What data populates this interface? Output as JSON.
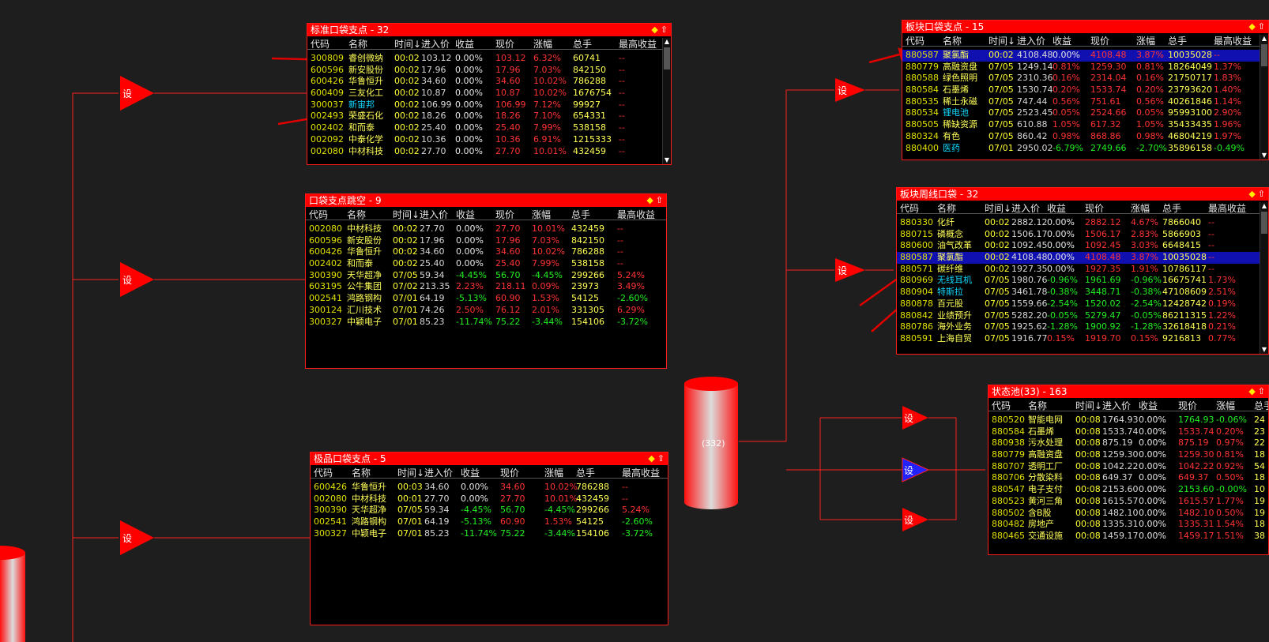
{
  "colors": {
    "background": "#1e1e1e",
    "accent": "#ff0000",
    "selected_row": "#1010b0",
    "rise": "#ff3333",
    "fall": "#22ee22",
    "switch_selected": "#2222ff"
  },
  "nodes": {
    "setting_label": "设",
    "pool_count": "(332)"
  },
  "panels": {
    "std": {
      "title": "标准口袋支点 - 32",
      "headers": [
        "代码",
        "名称",
        "时间↓",
        "进入价",
        "收益",
        "现价",
        "涨幅",
        "总手",
        "最高收益"
      ],
      "rows": [
        {
          "code": "300809",
          "name": "睿创微纳",
          "time": "00:02",
          "in": "103.12",
          "gain": "0.00%",
          "price": "103.12",
          "chg": "6.32%",
          "vol": "60741",
          "max": "--",
          "gc": "w",
          "pc": "r",
          "cc": "r"
        },
        {
          "code": "600596",
          "name": "新安股份",
          "time": "00:02",
          "in": "17.96",
          "gain": "0.00%",
          "price": "17.96",
          "chg": "7.03%",
          "vol": "842150",
          "max": "--",
          "gc": "w",
          "pc": "r",
          "cc": "r"
        },
        {
          "code": "600426",
          "name": "华鲁恒升",
          "time": "00:02",
          "in": "34.60",
          "gain": "0.00%",
          "price": "34.60",
          "chg": "10.02%",
          "vol": "786288",
          "max": "--",
          "gc": "w",
          "pc": "r",
          "cc": "r"
        },
        {
          "code": "600409",
          "name": "三友化工",
          "time": "00:02",
          "in": "10.87",
          "gain": "0.00%",
          "price": "10.87",
          "chg": "10.02%",
          "vol": "1676754",
          "max": "--",
          "gc": "w",
          "pc": "r",
          "cc": "r"
        },
        {
          "code": "300037",
          "name": "新宙邦",
          "time": "00:02",
          "in": "106.99",
          "gain": "0.00%",
          "price": "106.99",
          "chg": "7.12%",
          "vol": "99927",
          "max": "--",
          "gc": "w",
          "pc": "r",
          "cc": "r",
          "cyan": true
        },
        {
          "code": "002493",
          "name": "荣盛石化",
          "time": "00:02",
          "in": "18.26",
          "gain": "0.00%",
          "price": "18.26",
          "chg": "7.10%",
          "vol": "654331",
          "max": "--",
          "gc": "w",
          "pc": "r",
          "cc": "r"
        },
        {
          "code": "002402",
          "name": "和而泰",
          "time": "00:02",
          "in": "25.40",
          "gain": "0.00%",
          "price": "25.40",
          "chg": "7.99%",
          "vol": "538158",
          "max": "--",
          "gc": "w",
          "pc": "r",
          "cc": "r"
        },
        {
          "code": "002092",
          "name": "中泰化学",
          "time": "00:02",
          "in": "10.36",
          "gain": "0.00%",
          "price": "10.36",
          "chg": "6.91%",
          "vol": "1215333",
          "max": "--",
          "gc": "w",
          "pc": "r",
          "cc": "r"
        },
        {
          "code": "002080",
          "name": "中材科技",
          "time": "00:02",
          "in": "27.70",
          "gain": "0.00%",
          "price": "27.70",
          "chg": "10.01%",
          "vol": "432459",
          "max": "--",
          "gc": "w",
          "pc": "r",
          "cc": "r"
        }
      ]
    },
    "gap": {
      "title": "口袋支点跳空 - 9",
      "headers": [
        "代码",
        "名称",
        "时间↓",
        "进入价",
        "收益",
        "现价",
        "涨幅",
        "总手",
        "最高收益"
      ],
      "rows": [
        {
          "code": "002080",
          "name": "中材科技",
          "time": "00:02",
          "in": "27.70",
          "gain": "0.00%",
          "price": "27.70",
          "chg": "10.01%",
          "vol": "432459",
          "max": "--",
          "gc": "w",
          "pc": "r",
          "cc": "r"
        },
        {
          "code": "600596",
          "name": "新安股份",
          "time": "00:02",
          "in": "17.96",
          "gain": "0.00%",
          "price": "17.96",
          "chg": "7.03%",
          "vol": "842150",
          "max": "--",
          "gc": "w",
          "pc": "r",
          "cc": "r"
        },
        {
          "code": "600426",
          "name": "华鲁恒升",
          "time": "00:02",
          "in": "34.60",
          "gain": "0.00%",
          "price": "34.60",
          "chg": "10.02%",
          "vol": "786288",
          "max": "--",
          "gc": "w",
          "pc": "r",
          "cc": "r"
        },
        {
          "code": "002402",
          "name": "和而泰",
          "time": "00:02",
          "in": "25.40",
          "gain": "0.00%",
          "price": "25.40",
          "chg": "7.99%",
          "vol": "538158",
          "max": "--",
          "gc": "w",
          "pc": "r",
          "cc": "r"
        },
        {
          "code": "300390",
          "name": "天华超净",
          "time": "07/05",
          "in": "59.34",
          "gain": "-4.45%",
          "price": "56.70",
          "chg": "-4.45%",
          "vol": "299266",
          "max": "5.24%",
          "gc": "g",
          "pc": "g",
          "cc": "g",
          "mc": "r"
        },
        {
          "code": "603195",
          "name": "公牛集团",
          "time": "07/02",
          "in": "213.35",
          "gain": "2.23%",
          "price": "218.11",
          "chg": "0.09%",
          "vol": "23973",
          "max": "3.49%",
          "gc": "r",
          "pc": "r",
          "cc": "r",
          "mc": "r"
        },
        {
          "code": "002541",
          "name": "鸿路钢构",
          "time": "07/01",
          "in": "64.19",
          "gain": "-5.13%",
          "price": "60.90",
          "chg": "1.53%",
          "vol": "54125",
          "max": "-2.60%",
          "gc": "g",
          "pc": "r",
          "cc": "r",
          "mc": "g"
        },
        {
          "code": "300124",
          "name": "汇川技术",
          "time": "07/01",
          "in": "74.26",
          "gain": "2.50%",
          "price": "76.12",
          "chg": "2.01%",
          "vol": "331305",
          "max": "6.29%",
          "gc": "r",
          "pc": "r",
          "cc": "r",
          "mc": "r"
        },
        {
          "code": "300327",
          "name": "中颖电子",
          "time": "07/01",
          "in": "85.23",
          "gain": "-11.74%",
          "price": "75.22",
          "chg": "-3.44%",
          "vol": "154106",
          "max": "-3.72%",
          "gc": "g",
          "pc": "g",
          "cc": "g",
          "mc": "g"
        }
      ]
    },
    "elite": {
      "title": "极品口袋支点 - 5",
      "headers": [
        "代码",
        "名称",
        "时间↓",
        "进入价",
        "收益",
        "现价",
        "涨幅",
        "总手",
        "最高收益"
      ],
      "rows": [
        {
          "code": "600426",
          "name": "华鲁恒升",
          "time": "00:03",
          "in": "34.60",
          "gain": "0.00%",
          "price": "34.60",
          "chg": "10.02%",
          "vol": "786288",
          "max": "--",
          "gc": "w",
          "pc": "r",
          "cc": "r"
        },
        {
          "code": "002080",
          "name": "中材科技",
          "time": "00:01",
          "in": "27.70",
          "gain": "0.00%",
          "price": "27.70",
          "chg": "10.01%",
          "vol": "432459",
          "max": "--",
          "gc": "w",
          "pc": "r",
          "cc": "r"
        },
        {
          "code": "300390",
          "name": "天华超净",
          "time": "07/05",
          "in": "59.34",
          "gain": "-4.45%",
          "price": "56.70",
          "chg": "-4.45%",
          "vol": "299266",
          "max": "5.24%",
          "gc": "g",
          "pc": "g",
          "cc": "g",
          "mc": "r"
        },
        {
          "code": "002541",
          "name": "鸿路钢构",
          "time": "07/01",
          "in": "64.19",
          "gain": "-5.13%",
          "price": "60.90",
          "chg": "1.53%",
          "vol": "54125",
          "max": "-2.60%",
          "gc": "g",
          "pc": "r",
          "cc": "r",
          "mc": "g"
        },
        {
          "code": "300327",
          "name": "中颖电子",
          "time": "07/01",
          "in": "85.23",
          "gain": "-11.74%",
          "price": "75.22",
          "chg": "-3.44%",
          "vol": "154106",
          "max": "-3.72%",
          "gc": "g",
          "pc": "g",
          "cc": "g",
          "mc": "g"
        }
      ]
    },
    "sector": {
      "title": "板块口袋支点 - 15",
      "headers": [
        "代码",
        "名称",
        "时间↓",
        "进入价",
        "收益",
        "现价",
        "涨幅",
        "总手",
        "最高收益"
      ],
      "rows": [
        {
          "code": "880587",
          "name": "聚氯酯",
          "time": "00:02",
          "in": "4108.48",
          "gain": "0.00%",
          "price": "4108.48",
          "chg": "3.87%",
          "vol": "10035028",
          "max": "--",
          "gc": "w",
          "pc": "r",
          "cc": "r",
          "sel": true
        },
        {
          "code": "880779",
          "name": "高融资盘",
          "time": "07/05",
          "in": "1249.14",
          "gain": "0.81%",
          "price": "1259.30",
          "chg": "0.81%",
          "vol": "18264049",
          "max": "1.37%",
          "gc": "r",
          "pc": "r",
          "cc": "r",
          "mc": "r"
        },
        {
          "code": "880588",
          "name": "绿色照明",
          "time": "07/05",
          "in": "2310.36",
          "gain": "0.16%",
          "price": "2314.04",
          "chg": "0.16%",
          "vol": "21750717",
          "max": "1.83%",
          "gc": "r",
          "pc": "r",
          "cc": "r",
          "mc": "r"
        },
        {
          "code": "880584",
          "name": "石墨烯",
          "time": "07/05",
          "in": "1530.74",
          "gain": "0.20%",
          "price": "1533.74",
          "chg": "0.20%",
          "vol": "23793620",
          "max": "1.40%",
          "gc": "r",
          "pc": "r",
          "cc": "r",
          "mc": "r"
        },
        {
          "code": "880535",
          "name": "稀土永磁",
          "time": "07/05",
          "in": "747.44",
          "gain": "0.56%",
          "price": "751.61",
          "chg": "0.56%",
          "vol": "40261846",
          "max": "1.14%",
          "gc": "r",
          "pc": "r",
          "cc": "r",
          "mc": "r"
        },
        {
          "code": "880534",
          "name": "锂电池",
          "time": "07/05",
          "in": "2523.45",
          "gain": "0.05%",
          "price": "2524.66",
          "chg": "0.05%",
          "vol": "95993100",
          "max": "2.90%",
          "gc": "r",
          "pc": "r",
          "cc": "r",
          "mc": "r",
          "cyan": true
        },
        {
          "code": "880505",
          "name": "稀缺资源",
          "time": "07/05",
          "in": "610.88",
          "gain": "1.05%",
          "price": "617.32",
          "chg": "1.05%",
          "vol": "35433435",
          "max": "1.96%",
          "gc": "r",
          "pc": "r",
          "cc": "r",
          "mc": "r"
        },
        {
          "code": "880324",
          "name": "有色",
          "time": "07/05",
          "in": "860.42",
          "gain": "0.98%",
          "price": "868.86",
          "chg": "0.98%",
          "vol": "46804219",
          "max": "1.97%",
          "gc": "r",
          "pc": "r",
          "cc": "r",
          "mc": "r"
        },
        {
          "code": "880400",
          "name": "医药",
          "time": "07/01",
          "in": "2950.02",
          "gain": "-6.79%",
          "price": "2749.66",
          "chg": "-2.70%",
          "vol": "35896158",
          "max": "-0.49%",
          "gc": "g",
          "pc": "g",
          "cc": "g",
          "mc": "g",
          "cyan": true
        }
      ]
    },
    "weekly": {
      "title": "板块周线口袋 - 32",
      "headers": [
        "代码",
        "名称",
        "时间↓",
        "进入价",
        "收益",
        "现价",
        "涨幅",
        "总手",
        "最高收益"
      ],
      "rows": [
        {
          "code": "880330",
          "name": "化纤",
          "time": "00:02",
          "in": "2882.12",
          "gain": "0.00%",
          "price": "2882.12",
          "chg": "4.67%",
          "vol": "7866040",
          "max": "--",
          "gc": "w",
          "pc": "r",
          "cc": "r"
        },
        {
          "code": "880715",
          "name": "磷概念",
          "time": "00:02",
          "in": "1506.17",
          "gain": "0.00%",
          "price": "1506.17",
          "chg": "2.83%",
          "vol": "5866903",
          "max": "--",
          "gc": "w",
          "pc": "r",
          "cc": "r"
        },
        {
          "code": "880600",
          "name": "油气改革",
          "time": "00:02",
          "in": "1092.45",
          "gain": "0.00%",
          "price": "1092.45",
          "chg": "3.03%",
          "vol": "6648415",
          "max": "--",
          "gc": "w",
          "pc": "r",
          "cc": "r"
        },
        {
          "code": "880587",
          "name": "聚氯酯",
          "time": "00:02",
          "in": "4108.48",
          "gain": "0.00%",
          "price": "4108.48",
          "chg": "3.87%",
          "vol": "10035028",
          "max": "--",
          "gc": "w",
          "pc": "r",
          "cc": "r",
          "sel": true
        },
        {
          "code": "880571",
          "name": "碳纤维",
          "time": "00:02",
          "in": "1927.35",
          "gain": "0.00%",
          "price": "1927.35",
          "chg": "1.91%",
          "vol": "10786117",
          "max": "--",
          "gc": "w",
          "pc": "r",
          "cc": "r"
        },
        {
          "code": "880969",
          "name": "无线耳机",
          "time": "07/05",
          "in": "1980.76",
          "gain": "-0.96%",
          "price": "1961.69",
          "chg": "-0.96%",
          "vol": "16675741",
          "max": "1.73%",
          "gc": "g",
          "pc": "g",
          "cc": "g",
          "mc": "r",
          "cyan": true
        },
        {
          "code": "880904",
          "name": "特斯拉",
          "time": "07/05",
          "in": "3461.78",
          "gain": "-0.38%",
          "price": "3448.71",
          "chg": "-0.38%",
          "vol": "47108609",
          "max": "2.51%",
          "gc": "g",
          "pc": "g",
          "cc": "g",
          "mc": "r",
          "cyan": true
        },
        {
          "code": "880878",
          "name": "百元股",
          "time": "07/05",
          "in": "1559.66",
          "gain": "-2.54%",
          "price": "1520.02",
          "chg": "-2.54%",
          "vol": "12428742",
          "max": "0.19%",
          "gc": "g",
          "pc": "g",
          "cc": "g",
          "mc": "r"
        },
        {
          "code": "880842",
          "name": "业绩预升",
          "time": "07/05",
          "in": "5282.20",
          "gain": "-0.05%",
          "price": "5279.47",
          "chg": "-0.05%",
          "vol": "86211315",
          "max": "1.22%",
          "gc": "g",
          "pc": "g",
          "cc": "g",
          "mc": "r"
        },
        {
          "code": "880786",
          "name": "海外业务",
          "time": "07/05",
          "in": "1925.62",
          "gain": "-1.28%",
          "price": "1900.92",
          "chg": "-1.28%",
          "vol": "32618418",
          "max": "0.21%",
          "gc": "g",
          "pc": "g",
          "cc": "g",
          "mc": "r"
        },
        {
          "code": "880591",
          "name": "上海自贸",
          "time": "07/05",
          "in": "1916.77",
          "gain": "0.15%",
          "price": "1919.70",
          "chg": "0.15%",
          "vol": "9216813",
          "max": "0.77%",
          "gc": "r",
          "pc": "r",
          "cc": "r",
          "mc": "r"
        }
      ]
    },
    "state": {
      "title": "状态池(33) - 163",
      "headers": [
        "代码",
        "名称",
        "时间↓",
        "进入价",
        "收益",
        "现价",
        "涨幅",
        "总手"
      ],
      "rows": [
        {
          "code": "880520",
          "name": "智能电网",
          "time": "00:08",
          "in": "1764.93",
          "gain": "0.00%",
          "price": "1764.93",
          "chg": "-0.06%",
          "vol": "24",
          "gc": "w",
          "pc": "g",
          "cc": "g"
        },
        {
          "code": "880584",
          "name": "石墨烯",
          "time": "00:08",
          "in": "1533.74",
          "gain": "0.00%",
          "price": "1533.74",
          "chg": "0.20%",
          "vol": "23",
          "gc": "w",
          "pc": "r",
          "cc": "r"
        },
        {
          "code": "880938",
          "name": "污水处理",
          "time": "00:08",
          "in": "875.19",
          "gain": "0.00%",
          "price": "875.19",
          "chg": "0.97%",
          "vol": "22",
          "gc": "w",
          "pc": "r",
          "cc": "r"
        },
        {
          "code": "880779",
          "name": "高融资盘",
          "time": "00:08",
          "in": "1259.30",
          "gain": "0.00%",
          "price": "1259.30",
          "chg": "0.81%",
          "vol": "18",
          "gc": "w",
          "pc": "r",
          "cc": "r"
        },
        {
          "code": "880707",
          "name": "透明工厂",
          "time": "00:08",
          "in": "1042.22",
          "gain": "0.00%",
          "price": "1042.22",
          "chg": "0.92%",
          "vol": "54",
          "gc": "w",
          "pc": "r",
          "cc": "r"
        },
        {
          "code": "880706",
          "name": "分散染料",
          "time": "00:08",
          "in": "649.37",
          "gain": "0.00%",
          "price": "649.37",
          "chg": "0.50%",
          "vol": "18",
          "gc": "w",
          "pc": "r",
          "cc": "r"
        },
        {
          "code": "880547",
          "name": "电子支付",
          "time": "00:08",
          "in": "2153.60",
          "gain": "0.00%",
          "price": "2153.60",
          "chg": "-0.00%",
          "vol": "10",
          "gc": "w",
          "pc": "g",
          "cc": "g"
        },
        {
          "code": "880523",
          "name": "黄河三角",
          "time": "00:08",
          "in": "1615.57",
          "gain": "0.00%",
          "price": "1615.57",
          "chg": "1.77%",
          "vol": "19",
          "gc": "w",
          "pc": "r",
          "cc": "r"
        },
        {
          "code": "880502",
          "name": "含B股",
          "time": "00:08",
          "in": "1482.10",
          "gain": "0.00%",
          "price": "1482.10",
          "chg": "0.50%",
          "vol": "19",
          "gc": "w",
          "pc": "r",
          "cc": "r"
        },
        {
          "code": "880482",
          "name": "房地产",
          "time": "00:08",
          "in": "1335.31",
          "gain": "0.00%",
          "price": "1335.31",
          "chg": "1.54%",
          "vol": "18",
          "gc": "w",
          "pc": "r",
          "cc": "r"
        },
        {
          "code": "880465",
          "name": "交通设施",
          "time": "00:08",
          "in": "1459.17",
          "gain": "0.00%",
          "price": "1459.17",
          "chg": "1.51%",
          "vol": "38",
          "gc": "w",
          "pc": "r",
          "cc": "r"
        }
      ]
    }
  }
}
